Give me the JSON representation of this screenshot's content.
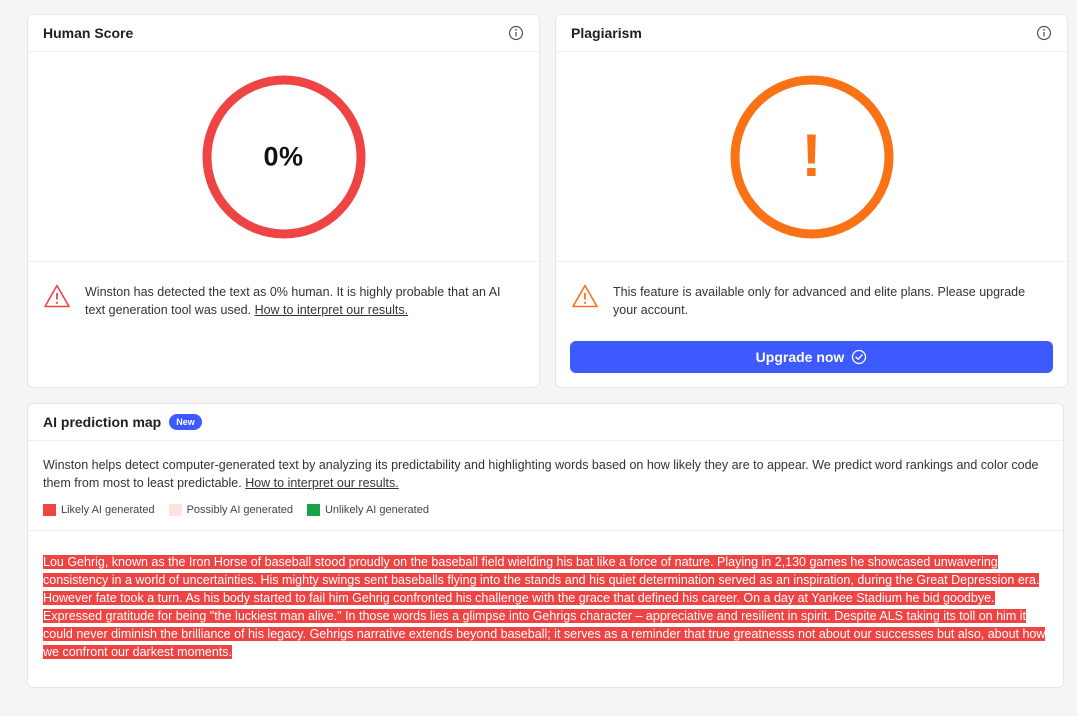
{
  "human_score": {
    "title": "Human Score",
    "value": "0%",
    "ring_color": "#ef4444",
    "notice": "Winston has detected the text as 0% human. It is highly probable that an AI text generation tool was used.",
    "link": "How to interpret our results."
  },
  "plagiarism": {
    "title": "Plagiarism",
    "symbol": "!",
    "ring_color": "#f97316",
    "notice": "This feature is available only for advanced and elite plans. Please upgrade your account.",
    "upgrade_label": "Upgrade now"
  },
  "prediction_map": {
    "title": "AI prediction map",
    "badge": "New",
    "description": "Winston helps detect computer-generated text by analyzing its predictability and highlighting words based on how likely they are to appear. We predict word rankings and color code them from most to least predictable.",
    "link": "How to interpret our results.",
    "legend": [
      {
        "label": "Likely AI generated",
        "color": "#ef4444"
      },
      {
        "label": "Possibly AI generated",
        "color": "#fde2e0"
      },
      {
        "label": "Unlikely AI generated",
        "color": "#16a34a"
      }
    ],
    "text": " Lou Gehrig, known as the Iron Horse of baseball stood proudly on the baseball field wielding his bat like a force of nature. Playing in 2,130 games he showcased unwavering consistency in a world of uncertainties. His mighty swings sent baseballs flying into the stands and his quiet determination served as an inspiration, during the Great Depression era. However fate took a turn. As his body started to fail him Gehrig confronted his challenge with the grace that defined his career. On a day at Yankee Stadium he bid goodbye. Expressed gratitude for being \"the luckiest man alive.\" In those words lies a glimpse into Gehrigs character – appreciative and resilient in spirit. Despite ALS taking its toll on him it could never diminish the brilliance of his legacy. Gehrigs narrative extends beyond baseball; it serves as a reminder that true greatnesss not about our successes but also, about how we confront our darkest moments."
  }
}
